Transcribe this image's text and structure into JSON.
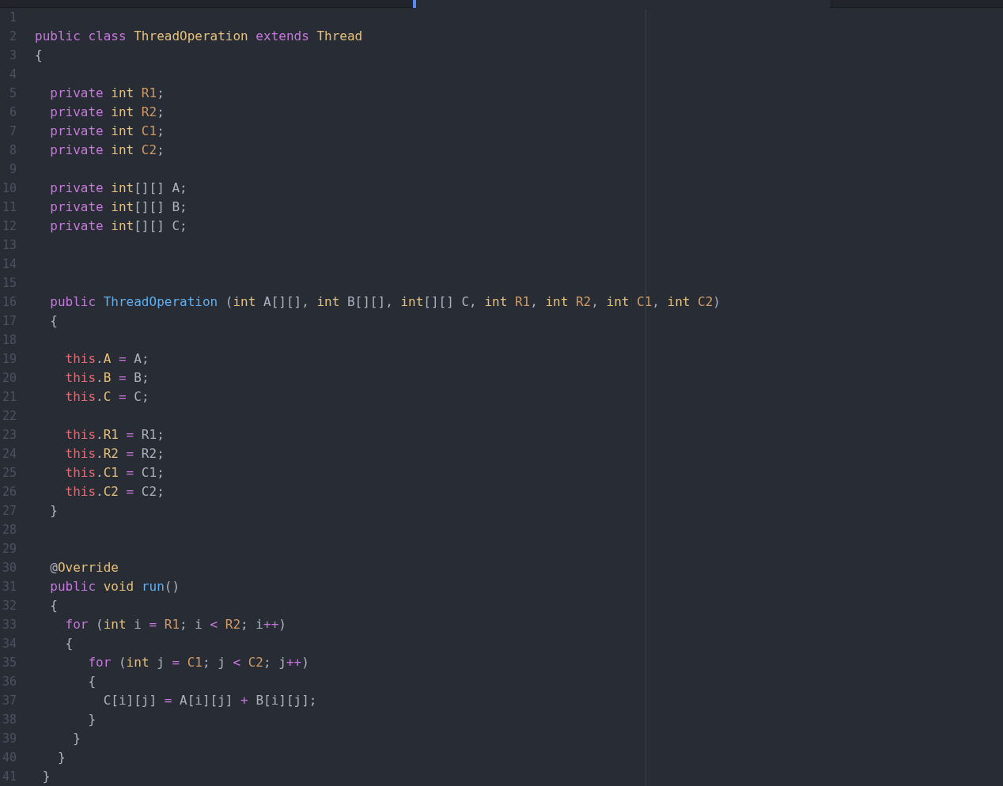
{
  "tabs": [
    {
      "selected": false
    },
    {
      "selected": true
    },
    {
      "selected": false
    }
  ],
  "editor": {
    "lines": [
      {
        "number": "1"
      },
      {
        "number": "2",
        "tokens": [
          {
            "kind": "keyword",
            "text": "public "
          },
          {
            "kind": "keyword",
            "text": "class "
          },
          {
            "kind": "type",
            "text": "ThreadOperation "
          },
          {
            "kind": "keyword",
            "text": "extends "
          },
          {
            "kind": "type",
            "text": "Thread"
          }
        ]
      },
      {
        "number": "3",
        "tokens": [
          {
            "kind": "plain",
            "text": "{"
          }
        ]
      },
      {
        "number": "4"
      },
      {
        "number": "5",
        "tokens": [
          {
            "kind": "keyword",
            "text": "  private "
          },
          {
            "kind": "type",
            "text": "int "
          },
          {
            "kind": "var",
            "text": "R1"
          },
          {
            "kind": "plain",
            "text": ";"
          }
        ]
      },
      {
        "number": "6",
        "tokens": [
          {
            "kind": "keyword",
            "text": "  private "
          },
          {
            "kind": "type",
            "text": "int "
          },
          {
            "kind": "var",
            "text": "R2"
          },
          {
            "kind": "plain",
            "text": ";"
          }
        ]
      },
      {
        "number": "7",
        "tokens": [
          {
            "kind": "keyword",
            "text": "  private "
          },
          {
            "kind": "type",
            "text": "int "
          },
          {
            "kind": "var",
            "text": "C1"
          },
          {
            "kind": "plain",
            "text": ";"
          }
        ]
      },
      {
        "number": "8",
        "tokens": [
          {
            "kind": "keyword",
            "text": "  private "
          },
          {
            "kind": "type",
            "text": "int "
          },
          {
            "kind": "var",
            "text": "C2"
          },
          {
            "kind": "plain",
            "text": ";"
          }
        ]
      },
      {
        "number": "9"
      },
      {
        "number": "10",
        "tokens": [
          {
            "kind": "keyword",
            "text": "  private "
          },
          {
            "kind": "type",
            "text": "int"
          },
          {
            "kind": "plain",
            "text": "[][] A;"
          }
        ]
      },
      {
        "number": "11",
        "tokens": [
          {
            "kind": "keyword",
            "text": "  private "
          },
          {
            "kind": "type",
            "text": "int"
          },
          {
            "kind": "plain",
            "text": "[][] B;"
          }
        ]
      },
      {
        "number": "12",
        "tokens": [
          {
            "kind": "keyword",
            "text": "  private "
          },
          {
            "kind": "type",
            "text": "int"
          },
          {
            "kind": "plain",
            "text": "[][] C;"
          }
        ]
      },
      {
        "number": "13"
      },
      {
        "number": "14"
      },
      {
        "number": "15"
      },
      {
        "number": "16",
        "tokens": [
          {
            "kind": "keyword",
            "text": "  public "
          },
          {
            "kind": "func",
            "text": "ThreadOperation "
          },
          {
            "kind": "plain",
            "text": "("
          },
          {
            "kind": "type",
            "text": "int "
          },
          {
            "kind": "plain",
            "text": "A[][], "
          },
          {
            "kind": "type",
            "text": "int "
          },
          {
            "kind": "plain",
            "text": "B[][], "
          },
          {
            "kind": "type",
            "text": "int"
          },
          {
            "kind": "plain",
            "text": "[][] C, "
          },
          {
            "kind": "type",
            "text": "int "
          },
          {
            "kind": "var",
            "text": "R1"
          },
          {
            "kind": "plain",
            "text": ", "
          },
          {
            "kind": "type",
            "text": "int "
          },
          {
            "kind": "var",
            "text": "R2"
          },
          {
            "kind": "plain",
            "text": ", "
          },
          {
            "kind": "type",
            "text": "int "
          },
          {
            "kind": "var",
            "text": "C1"
          },
          {
            "kind": "plain",
            "text": ", "
          },
          {
            "kind": "type",
            "text": "int "
          },
          {
            "kind": "var",
            "text": "C2"
          },
          {
            "kind": "plain",
            "text": ")"
          }
        ]
      },
      {
        "number": "17",
        "tokens": [
          {
            "kind": "plain",
            "text": "  {"
          }
        ]
      },
      {
        "number": "18"
      },
      {
        "number": "19",
        "tokens": [
          {
            "kind": "self",
            "text": "    this"
          },
          {
            "kind": "plain",
            "text": "."
          },
          {
            "kind": "prop",
            "text": "A"
          },
          {
            "kind": "op",
            "text": " ="
          },
          {
            "kind": "plain",
            "text": " A;"
          }
        ]
      },
      {
        "number": "20",
        "tokens": [
          {
            "kind": "self",
            "text": "    this"
          },
          {
            "kind": "plain",
            "text": "."
          },
          {
            "kind": "prop",
            "text": "B"
          },
          {
            "kind": "op",
            "text": " ="
          },
          {
            "kind": "plain",
            "text": " B;"
          }
        ]
      },
      {
        "number": "21",
        "tokens": [
          {
            "kind": "self",
            "text": "    this"
          },
          {
            "kind": "plain",
            "text": "."
          },
          {
            "kind": "prop",
            "text": "C"
          },
          {
            "kind": "op",
            "text": " ="
          },
          {
            "kind": "plain",
            "text": " C;"
          }
        ]
      },
      {
        "number": "22"
      },
      {
        "number": "23",
        "tokens": [
          {
            "kind": "self",
            "text": "    this"
          },
          {
            "kind": "plain",
            "text": "."
          },
          {
            "kind": "prop",
            "text": "R1"
          },
          {
            "kind": "op",
            "text": " ="
          },
          {
            "kind": "plain",
            "text": " R1;"
          }
        ]
      },
      {
        "number": "24",
        "tokens": [
          {
            "kind": "self",
            "text": "    this"
          },
          {
            "kind": "plain",
            "text": "."
          },
          {
            "kind": "prop",
            "text": "R2"
          },
          {
            "kind": "op",
            "text": " ="
          },
          {
            "kind": "plain",
            "text": " R2;"
          }
        ]
      },
      {
        "number": "25",
        "tokens": [
          {
            "kind": "self",
            "text": "    this"
          },
          {
            "kind": "plain",
            "text": "."
          },
          {
            "kind": "prop",
            "text": "C1"
          },
          {
            "kind": "op",
            "text": " ="
          },
          {
            "kind": "plain",
            "text": " C1;"
          }
        ]
      },
      {
        "number": "26",
        "tokens": [
          {
            "kind": "self",
            "text": "    this"
          },
          {
            "kind": "plain",
            "text": "."
          },
          {
            "kind": "prop",
            "text": "C2"
          },
          {
            "kind": "op",
            "text": " ="
          },
          {
            "kind": "plain",
            "text": " C2;"
          }
        ]
      },
      {
        "number": "27",
        "tokens": [
          {
            "kind": "plain",
            "text": "  }"
          }
        ]
      },
      {
        "number": "28"
      },
      {
        "number": "29"
      },
      {
        "number": "30",
        "tokens": [
          {
            "kind": "plain",
            "text": "  @"
          },
          {
            "kind": "type",
            "text": "Override"
          }
        ]
      },
      {
        "number": "31",
        "tokens": [
          {
            "kind": "keyword",
            "text": "  public "
          },
          {
            "kind": "type",
            "text": "void "
          },
          {
            "kind": "func",
            "text": "run"
          },
          {
            "kind": "plain",
            "text": "()"
          }
        ]
      },
      {
        "number": "32",
        "tokens": [
          {
            "kind": "plain",
            "text": "  {"
          }
        ]
      },
      {
        "number": "33",
        "tokens": [
          {
            "kind": "keyword",
            "text": "    for "
          },
          {
            "kind": "plain",
            "text": "("
          },
          {
            "kind": "type",
            "text": "int "
          },
          {
            "kind": "plain",
            "text": "i "
          },
          {
            "kind": "op",
            "text": "= "
          },
          {
            "kind": "var",
            "text": "R1"
          },
          {
            "kind": "plain",
            "text": "; i "
          },
          {
            "kind": "op",
            "text": "< "
          },
          {
            "kind": "var",
            "text": "R2"
          },
          {
            "kind": "plain",
            "text": "; i"
          },
          {
            "kind": "op",
            "text": "++"
          },
          {
            "kind": "plain",
            "text": ")"
          }
        ]
      },
      {
        "number": "34",
        "tokens": [
          {
            "kind": "plain",
            "text": "    {"
          }
        ]
      },
      {
        "number": "35",
        "tokens": [
          {
            "kind": "keyword",
            "text": "       for "
          },
          {
            "kind": "plain",
            "text": "("
          },
          {
            "kind": "type",
            "text": "int "
          },
          {
            "kind": "plain",
            "text": "j "
          },
          {
            "kind": "op",
            "text": "= "
          },
          {
            "kind": "var",
            "text": "C1"
          },
          {
            "kind": "plain",
            "text": "; j "
          },
          {
            "kind": "op",
            "text": "< "
          },
          {
            "kind": "var",
            "text": "C2"
          },
          {
            "kind": "plain",
            "text": "; j"
          },
          {
            "kind": "op",
            "text": "++"
          },
          {
            "kind": "plain",
            "text": ")"
          }
        ]
      },
      {
        "number": "36",
        "tokens": [
          {
            "kind": "plain",
            "text": "       {"
          }
        ]
      },
      {
        "number": "37",
        "tokens": [
          {
            "kind": "plain",
            "text": "         C[i][j] "
          },
          {
            "kind": "op",
            "text": "="
          },
          {
            "kind": "plain",
            "text": " A[i][j] "
          },
          {
            "kind": "op",
            "text": "+"
          },
          {
            "kind": "plain",
            "text": " B[i][j];"
          }
        ]
      },
      {
        "number": "38",
        "tokens": [
          {
            "kind": "plain",
            "text": "       }"
          }
        ]
      },
      {
        "number": "39",
        "tokens": [
          {
            "kind": "plain",
            "text": "     }"
          }
        ]
      },
      {
        "number": "40",
        "tokens": [
          {
            "kind": "plain",
            "text": "   }"
          }
        ]
      },
      {
        "number": "41",
        "tokens": [
          {
            "kind": "plain",
            "text": " }"
          }
        ]
      }
    ]
  }
}
